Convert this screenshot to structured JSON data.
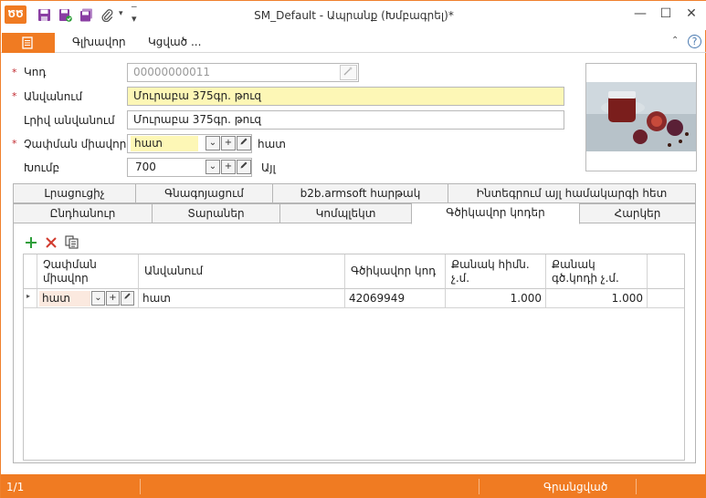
{
  "window": {
    "title": "SM_Default - Ապրանք (Խմբագրել)*",
    "logo": "ԾԾ",
    "controls": {
      "minimize": "—",
      "maximize": "☐",
      "close": "✕"
    }
  },
  "quick_access": {
    "dropdown": "▾"
  },
  "menu": {
    "items": [
      "Գլխավոր",
      "Կցված ..."
    ],
    "help": "?"
  },
  "form": {
    "code": {
      "label": "Կոդ",
      "value": "00000000011"
    },
    "name": {
      "label": "Անվանում",
      "value": "Մուրաբա 375գր. թուզ"
    },
    "full_name": {
      "label": "Լրիվ անվանում",
      "value": "Մուրաբա 375գր. թուզ"
    },
    "unit": {
      "label": "Չափման միավոր",
      "value": "հատ",
      "display": "հատ"
    },
    "group": {
      "label": "Խումբ",
      "value": "700",
      "display": "Այլ"
    },
    "required_mark": "*"
  },
  "tabs": {
    "row1": [
      "Լրացուցիչ",
      "Գնագոյացում",
      "b2b.armsoft հարթակ",
      "Ինտեգրում այլ համակարգի հետ"
    ],
    "row2": [
      "Ընդհանուր",
      "Տարաներ",
      "Կոմպլեկտ",
      "Գծիկավոր կոդեր",
      "Հարկեր"
    ],
    "active": "Գծիկավոր կոդեր"
  },
  "grid": {
    "columns": [
      "Չափման միավոր",
      "Անվանում",
      "Գծիկավոր կոդ",
      "Քանակ հիմն. չ.մ.",
      "Քանակ գծ.կոդի չ.մ."
    ],
    "rows": [
      {
        "unit": "հատ",
        "name": "հատ",
        "barcode": "42069949",
        "qty_base": "1.000",
        "qty_barcode": "1.000"
      }
    ]
  },
  "status": {
    "page": "1/1",
    "state": "Գրանցված"
  },
  "colors": {
    "accent": "#f07b22",
    "required": "#c0272d",
    "field_highlight": "#fdf7b6"
  }
}
